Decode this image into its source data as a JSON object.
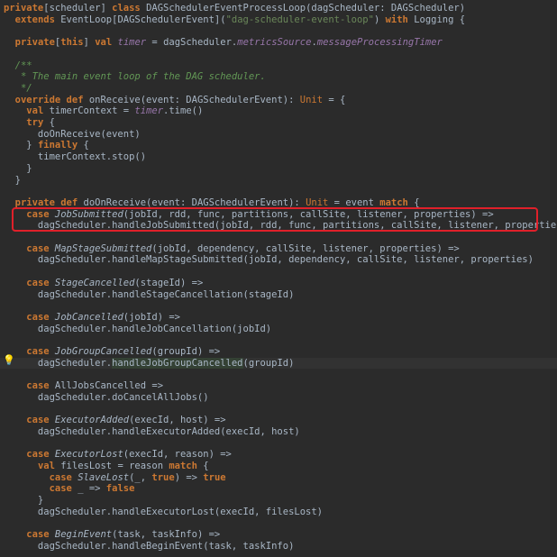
{
  "lines": [
    [
      [
        "kw",
        "private"
      ],
      [
        "plain",
        "[scheduler] "
      ],
      [
        "kw",
        "class "
      ],
      [
        "plain",
        "DAGSchedulerEventProcessLoop(dagScheduler: DAGScheduler)"
      ]
    ],
    [
      [
        "plain",
        "  "
      ],
      [
        "kw",
        "extends "
      ],
      [
        "plain",
        "EventLoop[DAGSchedulerEvent]("
      ],
      [
        "str",
        "\"dag-scheduler-event-loop\""
      ],
      [
        "plain",
        ") "
      ],
      [
        "kw",
        "with "
      ],
      [
        "plain",
        "Logging {"
      ]
    ],
    [],
    [
      [
        "plain",
        "  "
      ],
      [
        "kw",
        "private"
      ],
      [
        "plain",
        "["
      ],
      [
        "kw",
        "this"
      ],
      [
        "plain",
        "] "
      ],
      [
        "kw",
        "val "
      ],
      [
        "fld",
        "timer"
      ],
      [
        "plain",
        " = dagScheduler."
      ],
      [
        "fld",
        "metricsSource"
      ],
      [
        "plain",
        "."
      ],
      [
        "fld",
        "messageProcessingTimer"
      ]
    ],
    [],
    [
      [
        "cmt",
        "  /**"
      ]
    ],
    [
      [
        "cmt",
        "   * The main event loop of the DAG scheduler."
      ]
    ],
    [
      [
        "cmt",
        "   */"
      ]
    ],
    [
      [
        "plain",
        "  "
      ],
      [
        "kw",
        "override def "
      ],
      [
        "plain",
        "onReceive(event: DAGSchedulerEvent): "
      ],
      [
        "kwn",
        "Unit"
      ],
      [
        "plain",
        " = {"
      ]
    ],
    [
      [
        "plain",
        "    "
      ],
      [
        "kw",
        "val "
      ],
      [
        "plain",
        "timerContext = "
      ],
      [
        "fld",
        "timer"
      ],
      [
        "plain",
        ".time()"
      ]
    ],
    [
      [
        "plain",
        "    "
      ],
      [
        "kw",
        "try "
      ],
      [
        "plain",
        "{"
      ]
    ],
    [
      [
        "plain",
        "      doOnReceive(event)"
      ]
    ],
    [
      [
        "plain",
        "    } "
      ],
      [
        "kw",
        "finally "
      ],
      [
        "plain",
        "{"
      ]
    ],
    [
      [
        "plain",
        "      timerContext.stop()"
      ]
    ],
    [
      [
        "plain",
        "    }"
      ]
    ],
    [
      [
        "plain",
        "  }"
      ]
    ],
    [],
    [
      [
        "plain",
        "  "
      ],
      [
        "kw",
        "private def "
      ],
      [
        "plain",
        "doOnReceive(event: DAGSchedulerEvent): "
      ],
      [
        "kwn",
        "Unit"
      ],
      [
        "plain",
        " = event "
      ],
      [
        "kw",
        "match "
      ],
      [
        "plain",
        "{"
      ]
    ],
    [
      [
        "plain",
        "    "
      ],
      [
        "kw",
        "case "
      ],
      [
        "it",
        "JobSubmitted"
      ],
      [
        "plain",
        "(jobId, rdd, func, partitions, callSite, listener, properties) =>"
      ]
    ],
    [
      [
        "plain",
        "      dagScheduler.handleJobSubmitted(jobId, rdd, func, partitions, callSite, listener, properties)"
      ]
    ],
    [],
    [
      [
        "plain",
        "    "
      ],
      [
        "kw",
        "case "
      ],
      [
        "it",
        "MapStageSubmitted"
      ],
      [
        "plain",
        "(jobId, dependency, callSite, listener, properties) =>"
      ]
    ],
    [
      [
        "plain",
        "      dagScheduler.handleMapStageSubmitted(jobId, dependency, callSite, listener, properties)"
      ]
    ],
    [],
    [
      [
        "plain",
        "    "
      ],
      [
        "kw",
        "case "
      ],
      [
        "it",
        "StageCancelled"
      ],
      [
        "plain",
        "(stageId) =>"
      ]
    ],
    [
      [
        "plain",
        "      dagScheduler.handleStageCancellation(stageId)"
      ]
    ],
    [],
    [
      [
        "plain",
        "    "
      ],
      [
        "kw",
        "case "
      ],
      [
        "it",
        "JobCancelled"
      ],
      [
        "plain",
        "(jobId) =>"
      ]
    ],
    [
      [
        "plain",
        "      dagScheduler.handleJobCancellation(jobId)"
      ]
    ],
    [],
    [
      [
        "plain",
        "    "
      ],
      [
        "kw",
        "case "
      ],
      [
        "it",
        "JobGroupCancelled"
      ],
      [
        "plain",
        "(groupId) =>"
      ]
    ],
    [
      [
        "plain",
        "      dagScheduler."
      ],
      [
        "hl",
        "handleJobGroupCancelled"
      ],
      [
        "plain",
        "(groupId)"
      ]
    ],
    [],
    [
      [
        "plain",
        "    "
      ],
      [
        "kw",
        "case "
      ],
      [
        "plain",
        "AllJobsCancelled =>"
      ]
    ],
    [
      [
        "plain",
        "      dagScheduler.doCancelAllJobs()"
      ]
    ],
    [],
    [
      [
        "plain",
        "    "
      ],
      [
        "kw",
        "case "
      ],
      [
        "it",
        "ExecutorAdded"
      ],
      [
        "plain",
        "(execId, host) =>"
      ]
    ],
    [
      [
        "plain",
        "      dagScheduler.handleExecutorAdded(execId, host)"
      ]
    ],
    [],
    [
      [
        "plain",
        "    "
      ],
      [
        "kw",
        "case "
      ],
      [
        "it",
        "ExecutorLost"
      ],
      [
        "plain",
        "(execId, reason) =>"
      ]
    ],
    [
      [
        "plain",
        "      "
      ],
      [
        "kw",
        "val "
      ],
      [
        "plain",
        "filesLost = reason "
      ],
      [
        "kw",
        "match "
      ],
      [
        "plain",
        "{"
      ]
    ],
    [
      [
        "plain",
        "        "
      ],
      [
        "kw",
        "case "
      ],
      [
        "it",
        "SlaveLost"
      ],
      [
        "plain",
        "(_, "
      ],
      [
        "kw",
        "true"
      ],
      [
        "plain",
        ") => "
      ],
      [
        "kw",
        "true"
      ]
    ],
    [
      [
        "plain",
        "        "
      ],
      [
        "kw",
        "case "
      ],
      [
        "plain",
        "_ => "
      ],
      [
        "kw",
        "false"
      ]
    ],
    [
      [
        "plain",
        "      }"
      ]
    ],
    [
      [
        "plain",
        "      dagScheduler.handleExecutorLost(execId, filesLost)"
      ]
    ],
    [],
    [
      [
        "plain",
        "    "
      ],
      [
        "kw",
        "case "
      ],
      [
        "it",
        "BeginEvent"
      ],
      [
        "plain",
        "(task, taskInfo) =>"
      ]
    ],
    [
      [
        "plain",
        "      dagScheduler.handleBeginEvent(task, taskInfo)"
      ]
    ]
  ],
  "active_line": 31,
  "gutter_icon": "lightbulb-icon",
  "highlight": {
    "from_line": 18,
    "to_line": 19,
    "color": "#e0202a"
  }
}
